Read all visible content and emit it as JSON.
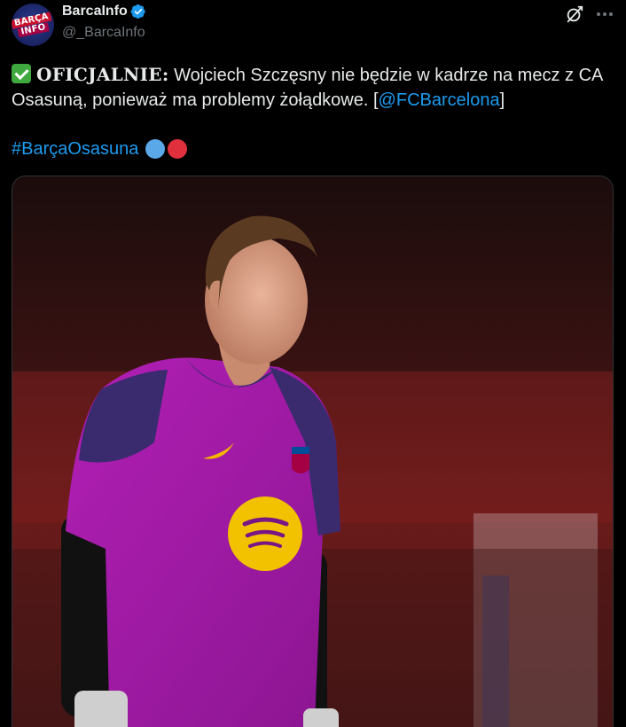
{
  "author": {
    "display_name": "BarcaInfo",
    "handle": "@_BarcaInfo",
    "avatar_text_top": "BARÇA",
    "avatar_text_bottom": "INFO",
    "verified": true
  },
  "icons": {
    "verified": "verified-badge-icon",
    "grok": "grok-icon",
    "more": "more-options-icon",
    "check": "check-mark-emoji-icon"
  },
  "tweet": {
    "prefix_bold": "OFICJALNIE:",
    "body": " Wojciech Szczęsny nie będzie w kadrze na mecz z CA Osasuną, ponieważ ma problemy żołądkowe. [",
    "mention": "@FCBarcelona",
    "suffix": "]",
    "hashtag": "#BarçaOsasuna"
  },
  "colors": {
    "link": "#1d9bf0",
    "verified": "#1d9bf0",
    "check_emoji": "#3fa93f",
    "dot_blue": "#5aa8e8",
    "dot_red": "#e0303d"
  },
  "media": {
    "type": "photo",
    "jersey_sponsor_icon": "spotify-logo-icon",
    "kit_logo_icon": "nike-swoosh-icon",
    "crest_icon": "fc-barcelona-crest-icon"
  }
}
